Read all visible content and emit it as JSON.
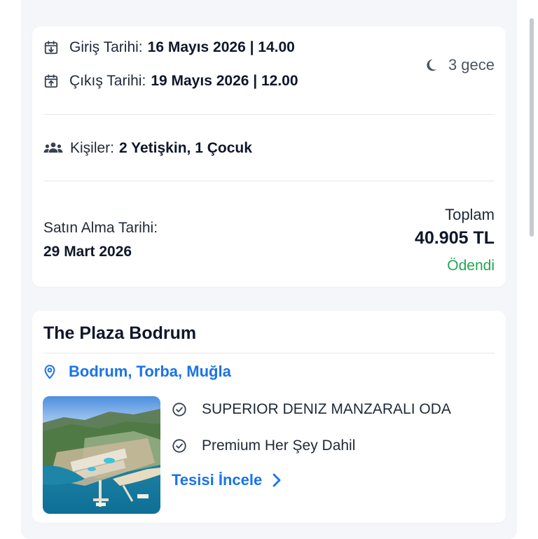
{
  "stay": {
    "checkin_label": "Giriş Tarihi:",
    "checkin_value": "16 Mayıs 2026 | 14.00",
    "checkout_label": "Çıkış Tarihi:",
    "checkout_value": "19 Mayıs 2026 | 12.00",
    "nights": "3 gece",
    "guests_label": "Kişiler:",
    "guests_value": "2 Yetişkin, 1 Çocuk",
    "purchase_label": "Satın Alma Tarihi:",
    "purchase_date": "29 Mart 2026",
    "total_label": "Toplam",
    "total_value": "40.905 TL",
    "payment_status": "Ödendi"
  },
  "hotel": {
    "name": "The Plaza Bodrum",
    "location": "Bodrum, Torba, Muğla",
    "features": [
      "SUPERIOR DENIZ MANZARALI ODA",
      "Premium Her Şey Dahil"
    ],
    "cta": "Tesisi İncele"
  },
  "colors": {
    "accent": "#1a73e8",
    "paid": "#22a552",
    "background": "#f4f6fa"
  },
  "icons": {
    "checkin": "calendar-download-icon",
    "checkout": "calendar-upload-icon",
    "nights": "moon-icon",
    "guests": "people-icon",
    "location": "location-pin-icon",
    "feature": "check-circle-icon",
    "cta": "chevron-right-icon"
  }
}
